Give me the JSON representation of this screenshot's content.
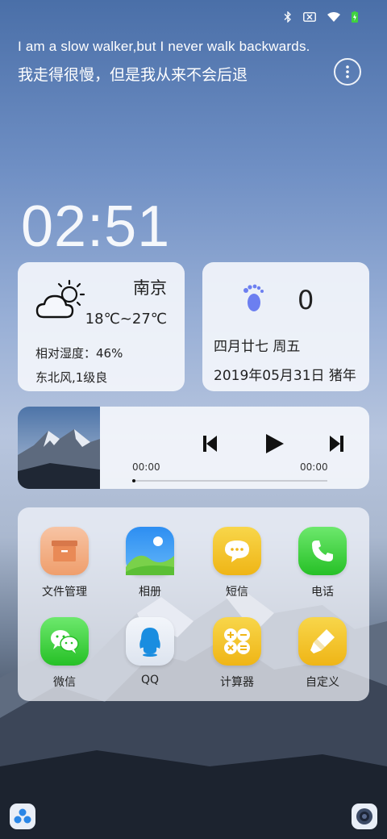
{
  "status_bar": {
    "icons": [
      "bluetooth-icon",
      "no-sim-icon",
      "wifi-icon",
      "battery-charging-icon"
    ]
  },
  "quote": {
    "english": "I am a slow walker,but I never walk backwards.",
    "chinese": "我走得很慢，但是我从来不会后退"
  },
  "clock": {
    "time": "02:51"
  },
  "weather": {
    "city": "南京",
    "temperature": "18℃~27℃",
    "humidity": "相对湿度：46%",
    "wind": "东北风,1级良",
    "icon": "partly-cloudy-icon"
  },
  "calendar": {
    "steps": "0",
    "lunar_date": "四月廿七 周五",
    "date": "2019年05月31日 猪年",
    "icon": "footprint-icon"
  },
  "player": {
    "current_time": "00:00",
    "total_time": "00:00",
    "progress": 0,
    "buttons": [
      "previous-icon",
      "play-icon",
      "next-icon"
    ]
  },
  "apps": [
    {
      "label": "文件管理",
      "icon": "file-manager-icon",
      "color": "#f0a070"
    },
    {
      "label": "相册",
      "icon": "gallery-icon",
      "color": "#3aa0f0"
    },
    {
      "label": "短信",
      "icon": "messages-icon",
      "color": "#f5c52b"
    },
    {
      "label": "电话",
      "icon": "phone-icon",
      "color": "#3fd23f"
    },
    {
      "label": "微信",
      "icon": "wechat-icon",
      "color": "#3fd23f"
    },
    {
      "label": "QQ",
      "icon": "qq-icon",
      "color": "#e8edf6"
    },
    {
      "label": "计算器",
      "icon": "calculator-icon",
      "color": "#f5c52b"
    },
    {
      "label": "自定义",
      "icon": "customize-brush-icon",
      "color": "#f5c52b"
    }
  ]
}
